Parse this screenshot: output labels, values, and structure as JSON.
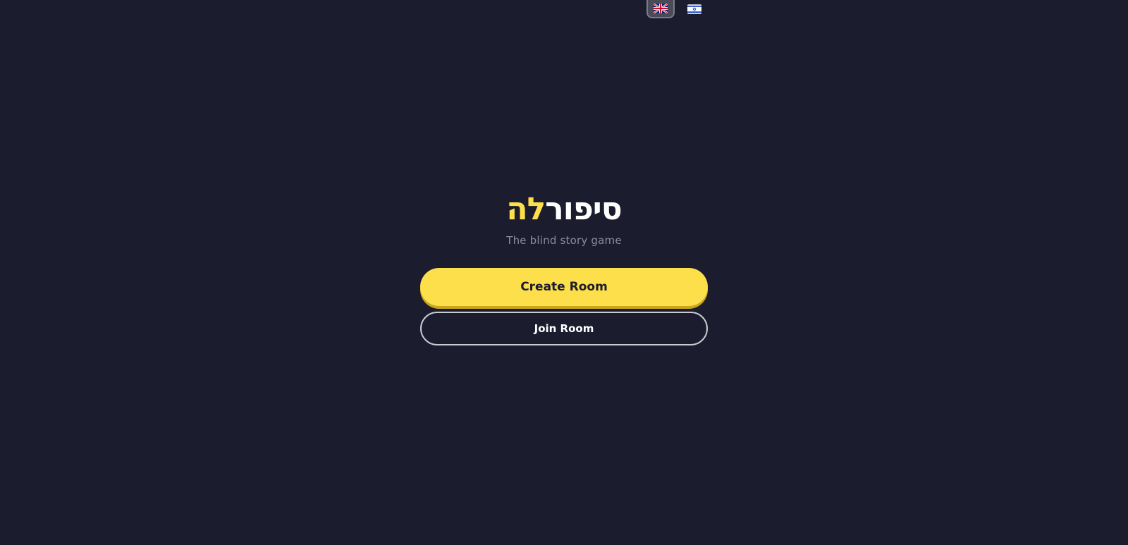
{
  "language_switcher": {
    "options": [
      {
        "flag": "uk-flag-icon",
        "active": true
      },
      {
        "flag": "israel-flag-icon",
        "active": false
      }
    ]
  },
  "logo": {
    "part_white": "סיפור",
    "part_yellow": "לה"
  },
  "subtitle": "The blind story game",
  "actions": {
    "create_label": "Create Room",
    "join_label": "Join Room"
  },
  "colors": {
    "background": "#1b1c2e",
    "accent": "#fddf4b",
    "muted_text": "#8b8d9c"
  }
}
